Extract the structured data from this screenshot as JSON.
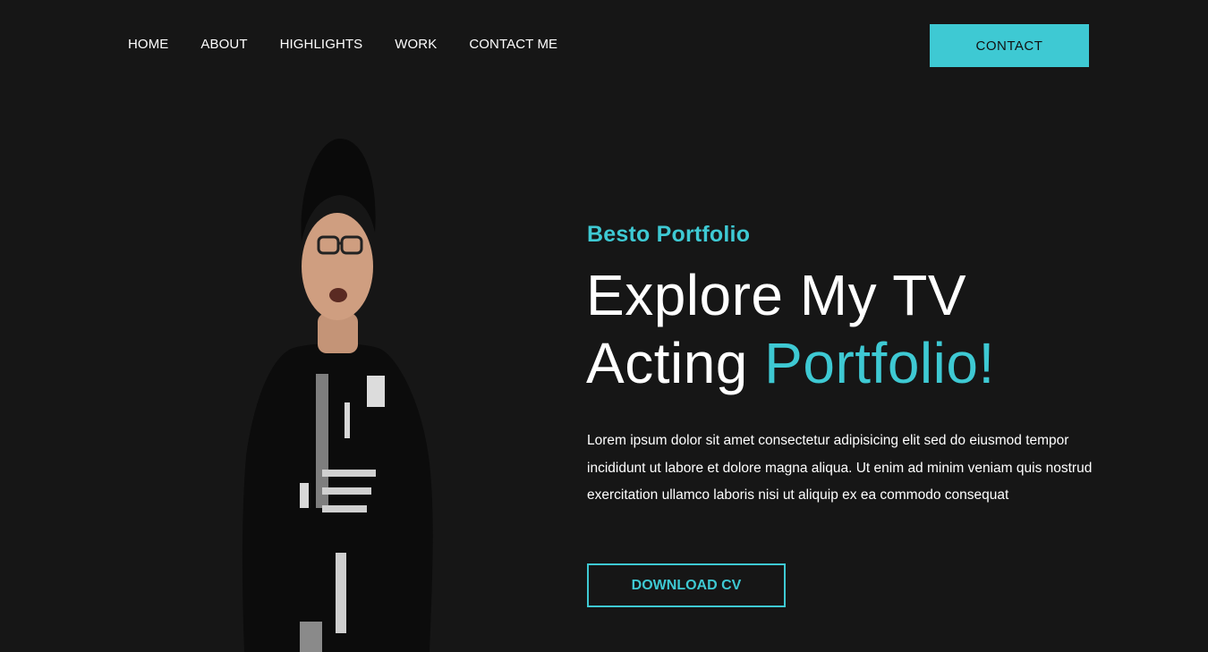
{
  "nav": {
    "items": [
      {
        "label": "HOME"
      },
      {
        "label": "ABOUT"
      },
      {
        "label": "HIGHLIGHTS"
      },
      {
        "label": "WORK"
      },
      {
        "label": "CONTACT ME"
      }
    ],
    "cta_label": "CONTACT"
  },
  "hero": {
    "kicker": "Besto Portfolio",
    "headline_line1": "Explore My TV",
    "headline_line2_plain": "Acting ",
    "headline_line2_accent": "Portfolio!",
    "description": "Lorem ipsum dolor sit amet consectetur adipisicing elit sed do eiusmod tempor incididunt ut labore et dolore magna aliqua. Ut enim ad minim veniam quis nostrud exercitation ullamco laboris nisi ut aliquip ex ea commodo consequat",
    "cv_button_label": "DOWNLOAD CV",
    "photo_icon": "person-photo"
  },
  "colors": {
    "background": "#161616",
    "accent": "#3ec9d3",
    "text": "#ffffff"
  }
}
